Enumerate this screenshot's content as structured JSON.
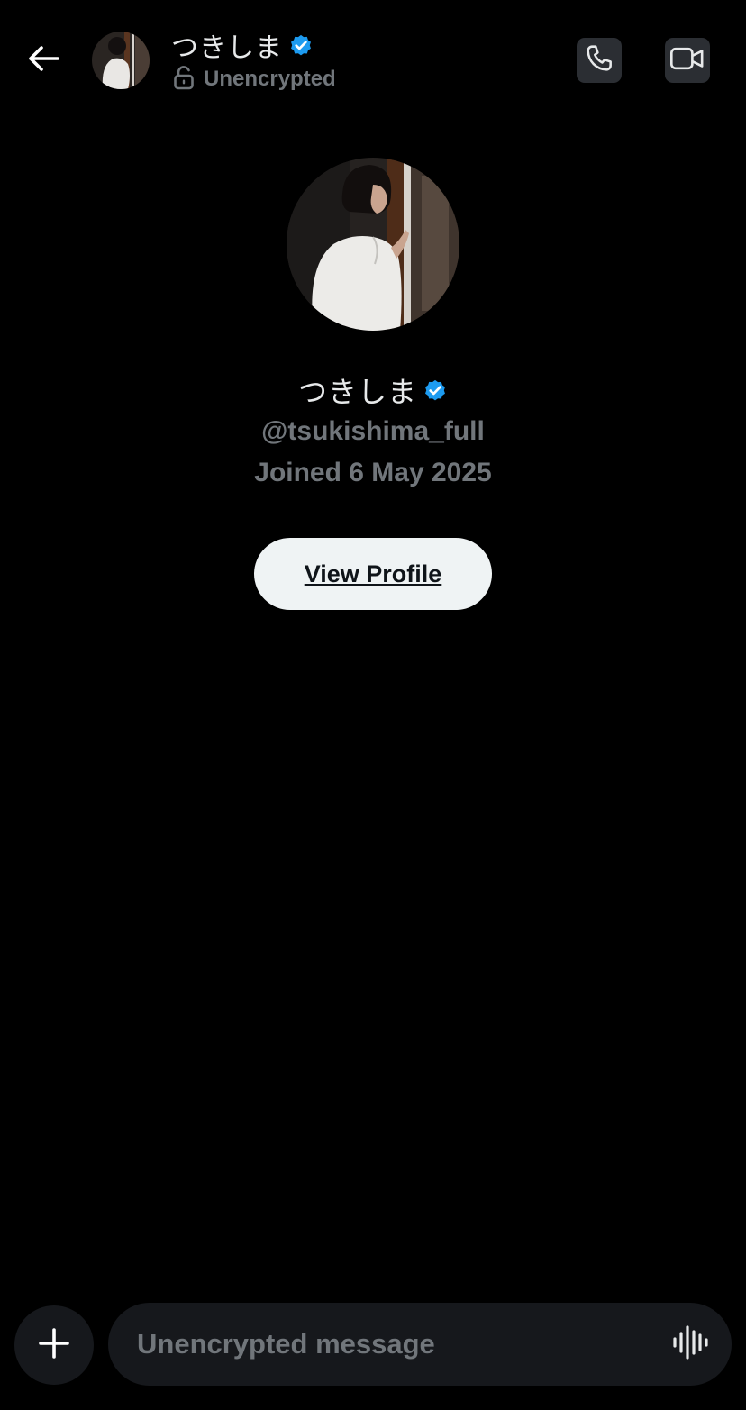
{
  "header": {
    "back_icon": "arrow-left-icon",
    "name": "つきしま",
    "verified_icon": "verified-badge-icon",
    "encryption_icon": "unlocked-padlock-icon",
    "encryption_status": "Unencrypted",
    "call_icon": "phone-icon",
    "video_icon": "video-camera-icon"
  },
  "profile": {
    "name": "つきしま",
    "handle": "@tsukishima_full",
    "joined": "Joined 6 May 2025",
    "view_profile_label": "View Profile"
  },
  "composer": {
    "add_icon": "plus-icon",
    "placeholder": "Unencrypted message",
    "value": "",
    "voice_icon": "voice-waveform-icon"
  },
  "colors": {
    "background": "#000000",
    "primary_text": "#e7e9ea",
    "secondary_text": "#71767b",
    "verified_blue": "#1d9bf0",
    "button_bg": "#eff3f4",
    "surface": "#16181c",
    "icon_button_bg": "#2b2e33"
  }
}
